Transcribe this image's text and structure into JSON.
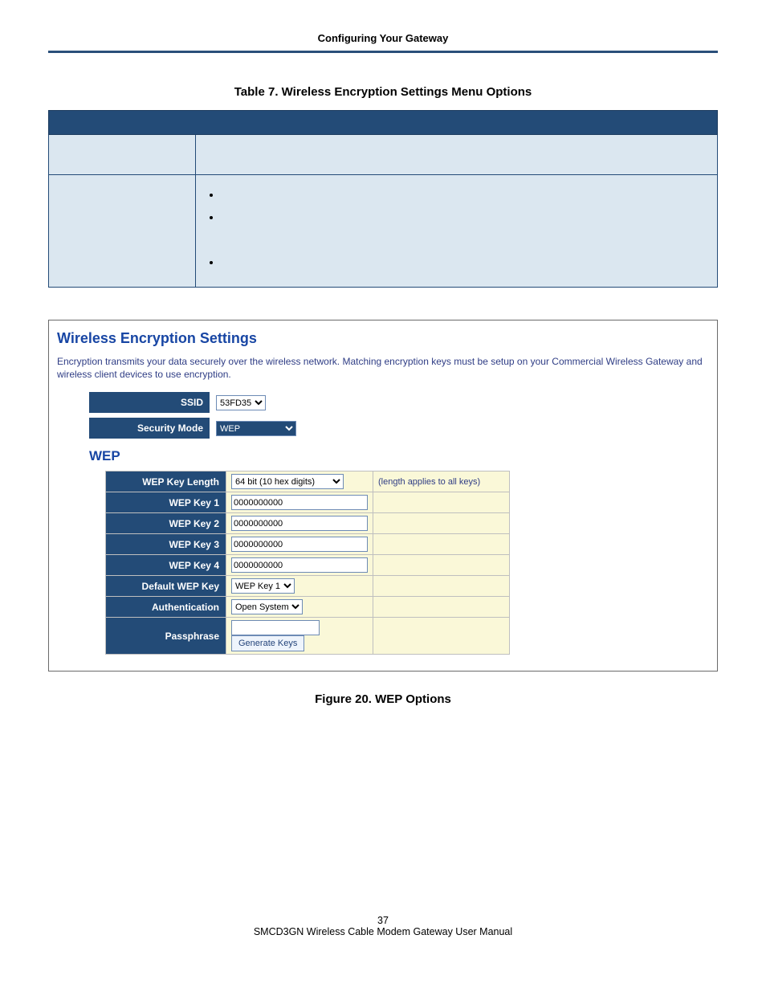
{
  "header": {
    "title": "Configuring Your Gateway"
  },
  "table": {
    "caption": "Table 7. Wireless Encryption Settings Menu Options",
    "rows": [
      {
        "a": "",
        "b": ""
      },
      {
        "a": "",
        "b_bullets": [
          "",
          "",
          ""
        ]
      }
    ]
  },
  "panel": {
    "title": "Wireless Encryption Settings",
    "desc": "Encryption transmits your data securely over the wireless network. Matching encryption keys must be setup on your Commercial Wireless Gateway and wireless client devices to use encryption.",
    "ssid": {
      "label": "SSID",
      "options": [
        "53FD35"
      ],
      "value": "53FD35"
    },
    "secmode": {
      "label": "Security Mode",
      "options": [
        "WEP"
      ],
      "value": "WEP"
    },
    "wep_heading": "WEP",
    "rows": {
      "keylen": {
        "label": "WEP Key Length",
        "options": [
          "64 bit (10 hex digits)"
        ],
        "value": "64 bit (10 hex digits)",
        "hint": "(length applies to all keys)"
      },
      "k1": {
        "label": "WEP Key 1",
        "value": "0000000000"
      },
      "k2": {
        "label": "WEP Key 2",
        "value": "0000000000"
      },
      "k3": {
        "label": "WEP Key 3",
        "value": "0000000000"
      },
      "k4": {
        "label": "WEP Key 4",
        "value": "0000000000"
      },
      "defkey": {
        "label": "Default WEP Key",
        "options": [
          "WEP Key 1"
        ],
        "value": "WEP Key 1"
      },
      "auth": {
        "label": "Authentication",
        "options": [
          "Open System"
        ],
        "value": "Open System"
      },
      "pass": {
        "label": "Passphrase",
        "value": "",
        "button": "Generate Keys"
      }
    }
  },
  "figure": {
    "caption": "Figure 20. WEP Options"
  },
  "footer": {
    "page": "37",
    "text": "SMCD3GN Wireless Cable Modem Gateway User Manual"
  }
}
